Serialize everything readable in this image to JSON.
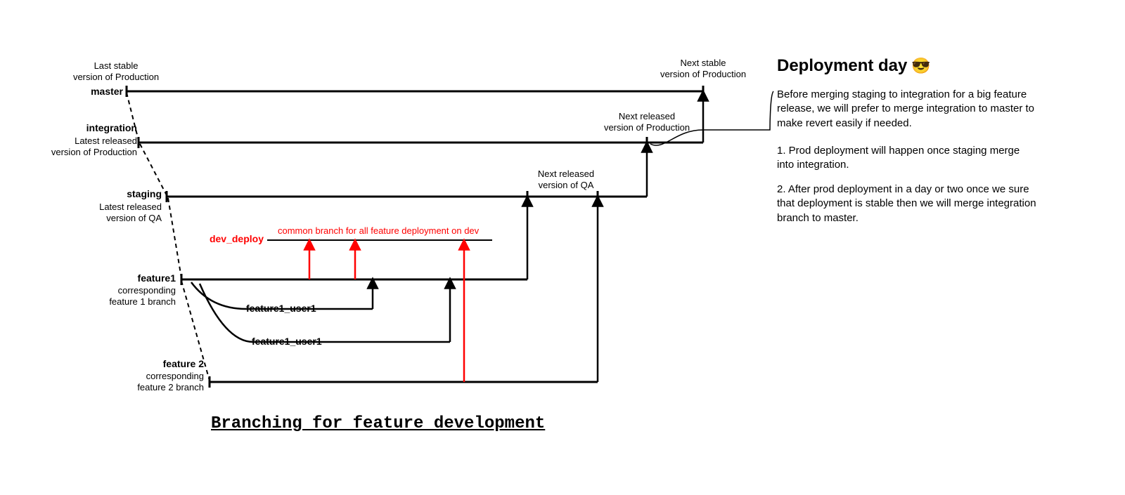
{
  "branches": {
    "master": {
      "name": "master",
      "note_above": "Last stable\nversion of Production",
      "right_note": "Next stable\nversion of Production"
    },
    "integration": {
      "name": "integration",
      "sub": "Latest released\nversion of Production",
      "right_note": "Next released\nversion of Production"
    },
    "staging": {
      "name": "staging",
      "sub": "Latest released\nversion of QA",
      "right_note": "Next released\nversion of QA"
    },
    "dev_deploy": {
      "name": "dev_deploy",
      "note": "common branch for all feature deployment on dev"
    },
    "feature1": {
      "name": "feature1",
      "sub": "corresponding\nfeature 1 branch"
    },
    "feature1_user1_a": "feature1_user1",
    "feature1_user1_b": "feature1_user1",
    "feature2": {
      "name": "feature 2",
      "sub": "corresponding\nfeature 2 branch"
    }
  },
  "title": "Branching for feature development",
  "side": {
    "heading": "Deployment day",
    "emoji": "😎",
    "para1": "Before merging staging to integration for a big feature release, we will prefer to merge integration to master to make revert easily if needed.",
    "item1": "1. Prod deployment will happen once staging merge into integration.",
    "item2": "2. After prod deployment in a day or two once we sure that deployment is stable then we will merge integration branch to master."
  }
}
